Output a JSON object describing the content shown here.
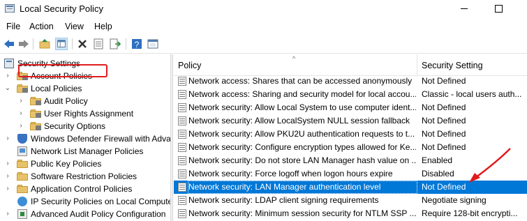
{
  "window": {
    "title": "Local Security Policy",
    "minimize_glyph": "",
    "maximize_glyph": ""
  },
  "menu": [
    "File",
    "Action",
    "View",
    "Help"
  ],
  "toolbar": {
    "icons": [
      "back-arrow-icon",
      "forward-arrow-icon",
      "up-folder-icon",
      "show-hide-tree-icon",
      "delete-icon",
      "properties-icon",
      "export-list-icon",
      "help-icon",
      "console-icon"
    ]
  },
  "tree": {
    "root": "Security Settings",
    "items": [
      {
        "label": "Account Policies",
        "level": 1,
        "expanded": false
      },
      {
        "label": "Local Policies",
        "level": 1,
        "expanded": true
      },
      {
        "label": "Audit Policy",
        "level": 2,
        "expanded": false
      },
      {
        "label": "User Rights Assignment",
        "level": 2,
        "expanded": false
      },
      {
        "label": "Security Options",
        "level": 2,
        "expanded": false,
        "highlighted": true
      },
      {
        "label": "Windows Defender Firewall with Adva",
        "level": 1,
        "expanded": false
      },
      {
        "label": "Network List Manager Policies",
        "level": 1,
        "expanded": false
      },
      {
        "label": "Public Key Policies",
        "level": 1,
        "expanded": false
      },
      {
        "label": "Software Restriction Policies",
        "level": 1,
        "expanded": false
      },
      {
        "label": "Application Control Policies",
        "level": 1,
        "expanded": false
      },
      {
        "label": "IP Security Policies on Local Compute",
        "level": 1,
        "expanded": false
      },
      {
        "label": "Advanced Audit Policy Configuration",
        "level": 1,
        "expanded": false
      }
    ]
  },
  "list": {
    "columns": {
      "policy": "Policy",
      "setting": "Security Setting"
    },
    "rows": [
      {
        "policy": "Network access: Shares that can be accessed anonymously",
        "setting": "Not Defined"
      },
      {
        "policy": "Network access: Sharing and security model for local accou...",
        "setting": "Classic - local users auth..."
      },
      {
        "policy": "Network security: Allow Local System to use computer ident...",
        "setting": "Not Defined"
      },
      {
        "policy": "Network security: Allow LocalSystem NULL session fallback",
        "setting": "Not Defined"
      },
      {
        "policy": "Network security: Allow PKU2U authentication requests to t...",
        "setting": "Not Defined"
      },
      {
        "policy": "Network security: Configure encryption types allowed for Ke...",
        "setting": "Not Defined"
      },
      {
        "policy": "Network security: Do not store LAN Manager hash value on ...",
        "setting": "Enabled"
      },
      {
        "policy": "Network security: Force logoff when logon hours expire",
        "setting": "Disabled"
      },
      {
        "policy": "Network security: LAN Manager authentication level",
        "setting": "Not Defined",
        "selected": true
      },
      {
        "policy": "Network security: LDAP client signing requirements",
        "setting": "Negotiate signing"
      },
      {
        "policy": "Network security: Minimum session security for NTLM SSP ...",
        "setting": "Require 128-bit encrypti..."
      }
    ]
  },
  "colors": {
    "selection": "#0078d7",
    "annotation": "#e01b1b"
  }
}
